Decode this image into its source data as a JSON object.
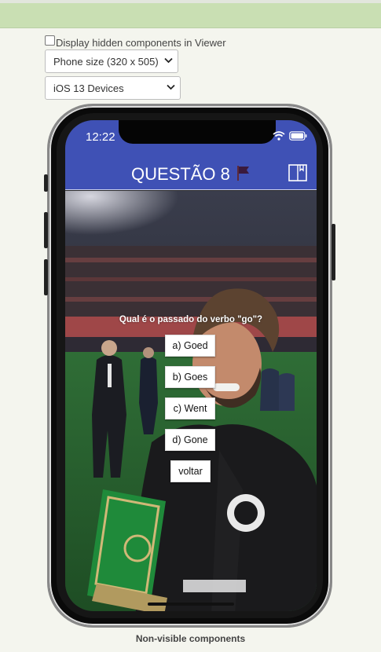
{
  "designer": {
    "hidden_checkbox_label": "Display hidden components in Viewer",
    "size_select_value": "Phone size (320 x 505)",
    "device_select_value": "iOS 13 Devices",
    "nonvisible_label": "Non-visible components"
  },
  "phone": {
    "status_time": "12:22",
    "title": "QUESTÃO 8",
    "question": "Qual é o passado do verbo \"go\"?",
    "answers": [
      "a) Goed",
      "b) Goes",
      "c) Went",
      "d) Gone"
    ],
    "back_label": "voltar",
    "colors": {
      "titlebar": "#3f51b5",
      "designer_bg": "#f4f5ee",
      "top_strip": "#c9dfb3"
    }
  }
}
